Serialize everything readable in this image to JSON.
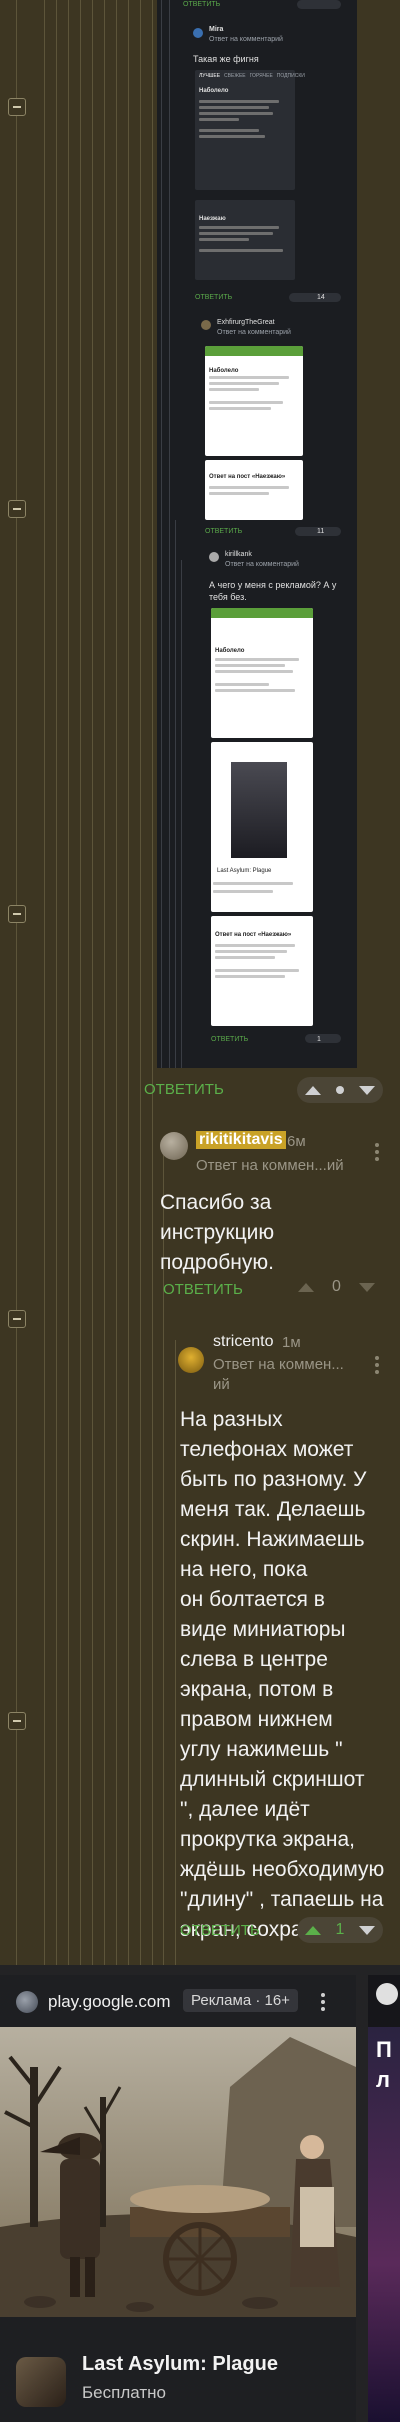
{
  "thread_top": {
    "reply_label_top": "ОТВЕТИТЬ",
    "embed_comment_1_author": "Mira",
    "embed_comment_1_meta": "Ответ на комментарий",
    "embed_comment_1_text": "Такая же фигня",
    "embed_tabs": [
      "ЛУЧШЕЕ",
      "СВЕЖЕЕ",
      "ГОРЯЧЕЕ",
      "ПОДПИСКИ"
    ],
    "embed_post_title_1": "Наболело",
    "embed_post_title_2": "Наезжаю",
    "embed_reply_1": "ОТВЕТИТЬ",
    "embed_score_1": "14",
    "embed_comment_2_author": "ExhfirurgTheGreat",
    "embed_comment_2_meta": "Ответ на комментарий",
    "embed_post_title_3": "Наболело",
    "embed_post_title_4": "Ответ на пост «Наезжаю»",
    "embed_reply_2": "ОТВЕТИТЬ",
    "embed_score_2": "11",
    "embed_comment_3_author": "kirillkank",
    "embed_comment_3_meta": "Ответ на комментарий",
    "embed_comment_3_text_1": "А чего у меня с рекламой? А у",
    "embed_comment_3_text_2": "тебя без.",
    "embed_post_title_5": "Наболело",
    "embed_ad_title": "Last Asylum: Plague",
    "embed_post_title_6": "Ответ на пост «Наезжаю»",
    "embed_reply_3": "ОТВЕТИТЬ",
    "embed_score_3": "1"
  },
  "comment_root_actions": {
    "reply_label": "ОТВЕТИТЬ"
  },
  "comment_1": {
    "username": "rikitikitavis",
    "time": "6м",
    "meta": "Ответ на коммен...ий",
    "text_lines": [
      "Спасибо за",
      "инструкцию",
      "подробную."
    ],
    "reply_label": "ОТВЕТИТЬ",
    "score": "0"
  },
  "comment_2": {
    "username": "stricento",
    "time": "1м",
    "meta_line1": "Ответ на коммен...",
    "meta_line2": "ий",
    "text_lines": [
      "На разных",
      "телефонах может",
      "быть по разному. У",
      "меня так. Делаешь",
      "скрин. Нажимаешь",
      "на него, пока",
      "он болтается в",
      "виде миниатюры",
      "слева в центре",
      "экрана, потом в",
      "правом нижнем",
      "углу нажимешь \"",
      "длинный скриншот",
      "\", далее идёт",
      "прокрутка экрана,",
      "ждёшь необходимую",
      "\"длину\" , тапаешь на",
      "экран, сохраняешь."
    ],
    "reply_label": "ОТВЕТИТЬ",
    "score": "1"
  },
  "ad": {
    "domain": "play.google.com",
    "badge": "Реклама · 16+",
    "app_title": "Last Asylum: Plague",
    "app_price": "Бесплатно",
    "next_card_letters": [
      "П",
      "л"
    ]
  },
  "colors": {
    "accent_green": "#5bb04a",
    "username_highlight": "#c9a227",
    "background": "#3d3622"
  },
  "icons": [
    "collapse-icon",
    "arrow-up-icon",
    "arrow-down-icon",
    "kebab-icon",
    "globe-icon"
  ]
}
